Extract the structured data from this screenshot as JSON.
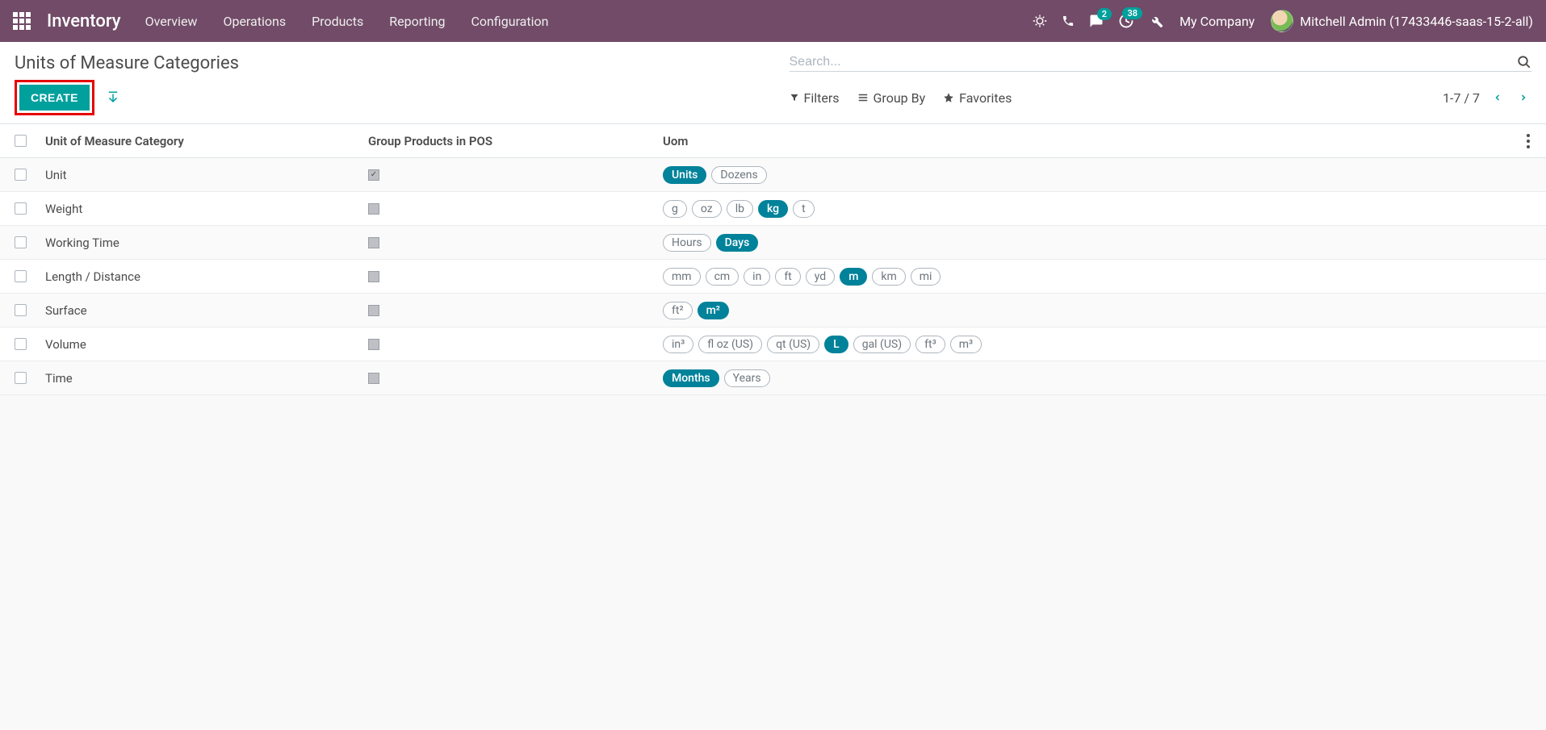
{
  "navbar": {
    "brand": "Inventory",
    "menu": [
      "Overview",
      "Operations",
      "Products",
      "Reporting",
      "Configuration"
    ],
    "badges": {
      "messages": "2",
      "activities": "38"
    },
    "company": "My Company",
    "user": "Mitchell Admin (17433446-saas-15-2-all)"
  },
  "control_panel": {
    "title": "Units of Measure Categories",
    "create_label": "CREATE",
    "search_placeholder": "Search...",
    "filters_label": "Filters",
    "groupby_label": "Group By",
    "favorites_label": "Favorites",
    "pager": "1-7 / 7"
  },
  "columns": {
    "category": "Unit of Measure Category",
    "group_pos": "Group Products in POS",
    "uom": "Uom"
  },
  "rows": [
    {
      "name": "Unit",
      "group_pos": true,
      "uoms": [
        {
          "label": "Units",
          "active": true
        },
        {
          "label": "Dozens",
          "active": false
        }
      ]
    },
    {
      "name": "Weight",
      "group_pos": false,
      "uoms": [
        {
          "label": "g",
          "active": false
        },
        {
          "label": "oz",
          "active": false
        },
        {
          "label": "lb",
          "active": false
        },
        {
          "label": "kg",
          "active": true
        },
        {
          "label": "t",
          "active": false
        }
      ]
    },
    {
      "name": "Working Time",
      "group_pos": false,
      "uoms": [
        {
          "label": "Hours",
          "active": false
        },
        {
          "label": "Days",
          "active": true
        }
      ]
    },
    {
      "name": "Length / Distance",
      "group_pos": false,
      "uoms": [
        {
          "label": "mm",
          "active": false
        },
        {
          "label": "cm",
          "active": false
        },
        {
          "label": "in",
          "active": false
        },
        {
          "label": "ft",
          "active": false
        },
        {
          "label": "yd",
          "active": false
        },
        {
          "label": "m",
          "active": true
        },
        {
          "label": "km",
          "active": false
        },
        {
          "label": "mi",
          "active": false
        }
      ]
    },
    {
      "name": "Surface",
      "group_pos": false,
      "uoms": [
        {
          "label": "ft²",
          "active": false
        },
        {
          "label": "m²",
          "active": true
        }
      ]
    },
    {
      "name": "Volume",
      "group_pos": false,
      "uoms": [
        {
          "label": "in³",
          "active": false
        },
        {
          "label": "fl oz (US)",
          "active": false
        },
        {
          "label": "qt (US)",
          "active": false
        },
        {
          "label": "L",
          "active": true
        },
        {
          "label": "gal (US)",
          "active": false
        },
        {
          "label": "ft³",
          "active": false
        },
        {
          "label": "m³",
          "active": false
        }
      ]
    },
    {
      "name": "Time",
      "group_pos": false,
      "uoms": [
        {
          "label": "Months",
          "active": true
        },
        {
          "label": "Years",
          "active": false
        }
      ]
    }
  ]
}
